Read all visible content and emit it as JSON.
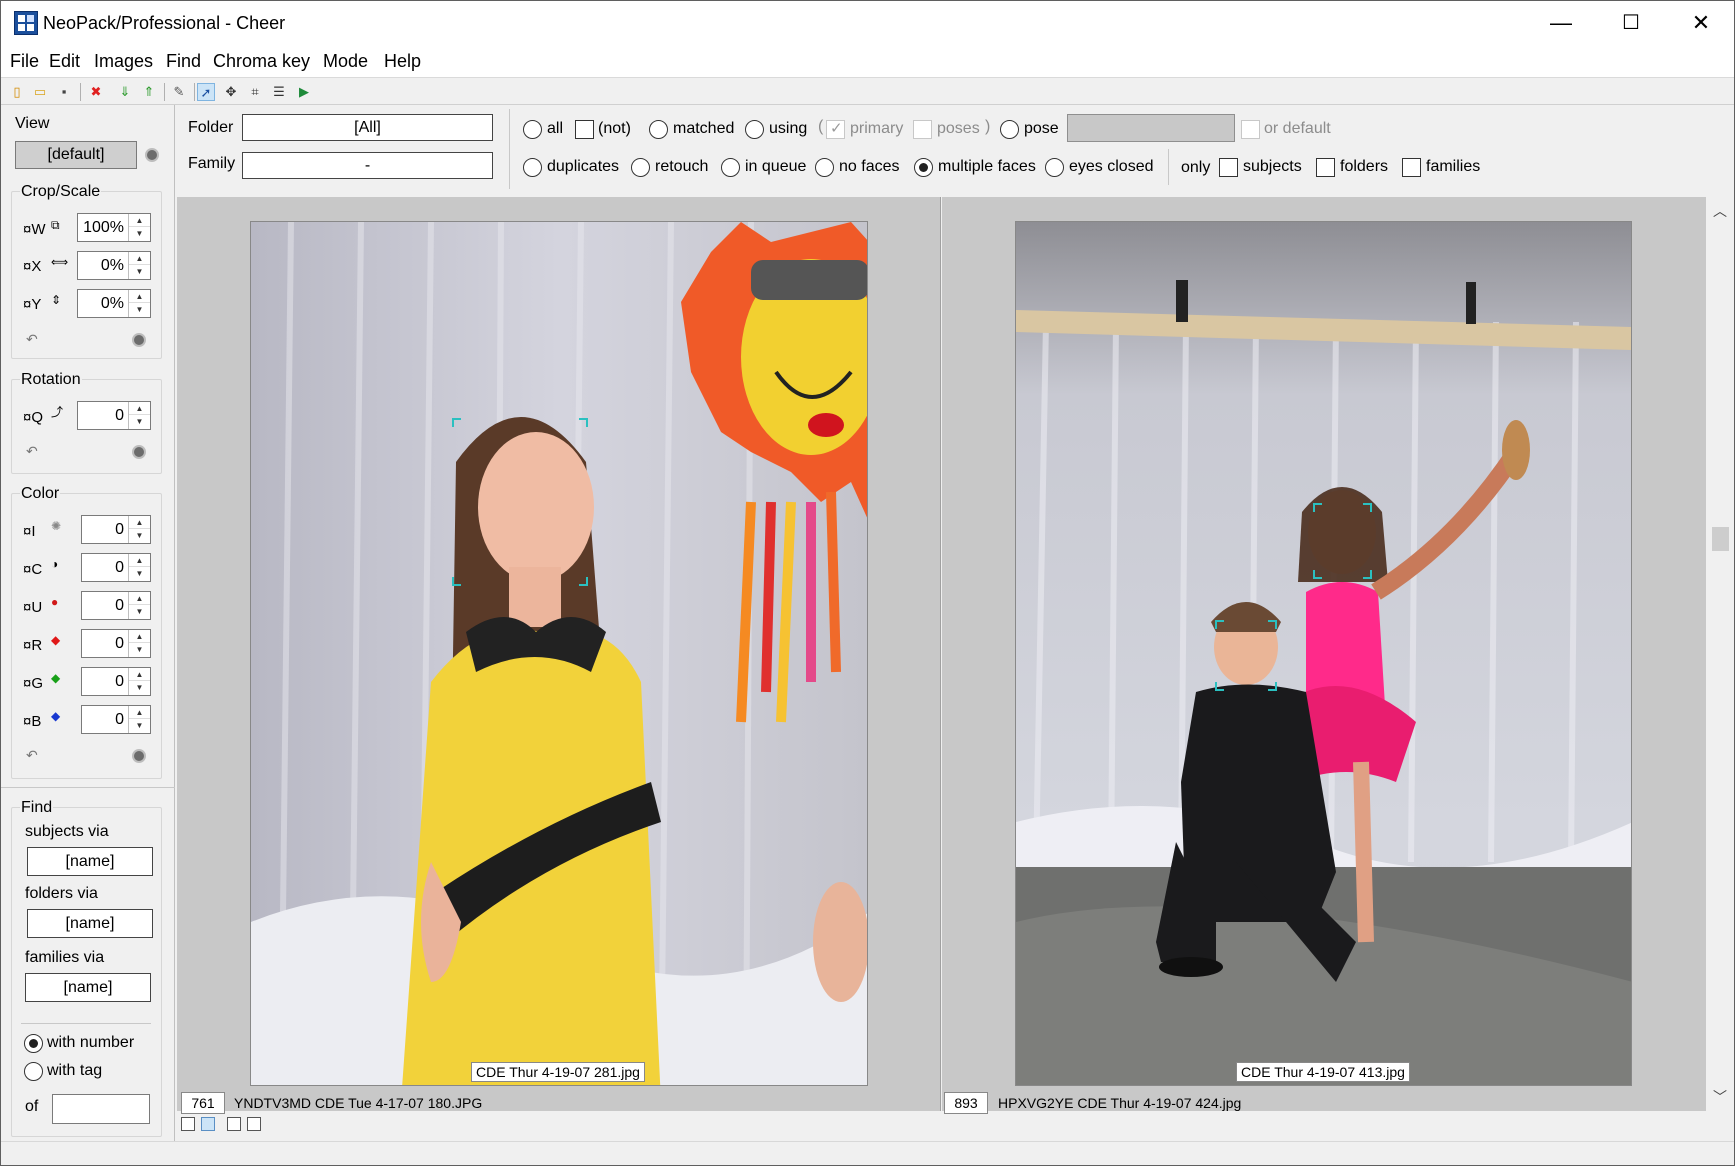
{
  "window": {
    "title": "NeoPack/Professional - Cheer",
    "minimize": "—",
    "maximize": "☐",
    "close": "✕"
  },
  "menu": [
    "File",
    "Edit",
    "Images",
    "Find",
    "Chroma key",
    "Mode",
    "Help"
  ],
  "left": {
    "view_label": "View",
    "view_button": "[default]",
    "crop_label": "Crop/Scale",
    "w_label": "¤W",
    "w_value": "100%",
    "x_label": "¤X",
    "x_value": "0%",
    "y_label": "¤Y",
    "y_value": "0%",
    "rotation_label": "Rotation",
    "q_label": "¤Q",
    "q_value": "0",
    "color_label": "Color",
    "i_label": "¤I",
    "i_value": "0",
    "c_label": "¤C",
    "c_value": "0",
    "u_label": "¤U",
    "u_value": "0",
    "r_label": "¤R",
    "r_value": "0",
    "g_label": "¤G",
    "g_value": "0",
    "b_label": "¤B",
    "b_value": "0",
    "find_label": "Find",
    "subjects_via": "subjects via",
    "subjects_field": "[name]",
    "folders_via": "folders via",
    "folders_field": "[name]",
    "families_via": "families via",
    "families_field": "[name]",
    "with_number": "with number",
    "with_tag": "with tag",
    "of_label": "of",
    "of_value": ""
  },
  "filter": {
    "folder_label": "Folder",
    "folder_value": "[All]",
    "family_label": "Family",
    "family_value": "-",
    "all": "all",
    "not": "(not)",
    "matched": "matched",
    "using": "using",
    "paren_open": "(",
    "primary": "primary",
    "poses": "poses",
    "paren_close": ")",
    "pose": "pose",
    "or_default": "or default",
    "duplicates": "duplicates",
    "retouch": "retouch",
    "in_queue": "in queue",
    "no_faces": "no faces",
    "multiple_faces": "multiple faces",
    "eyes_closed": "eyes closed",
    "only": "only",
    "subjects": "subjects",
    "folders": "folders",
    "families": "families"
  },
  "images": [
    {
      "number": "761",
      "filename": "YNDTV3MD CDE Tue 4-17-07 180.JPG",
      "caption": "CDE Thur 4-19-07 281.jpg"
    },
    {
      "number": "893",
      "filename": "HPXVG2YE CDE Thur 4-19-07 424.jpg",
      "caption": "CDE Thur 4-19-07 413.jpg"
    }
  ],
  "scrollbar": {
    "up": "︿",
    "down": "﹀"
  },
  "colors": {
    "accent_face_box": "#2bc0c0",
    "window_bg": "#f0f0f0",
    "image_area_bg": "#c8c8c8"
  }
}
